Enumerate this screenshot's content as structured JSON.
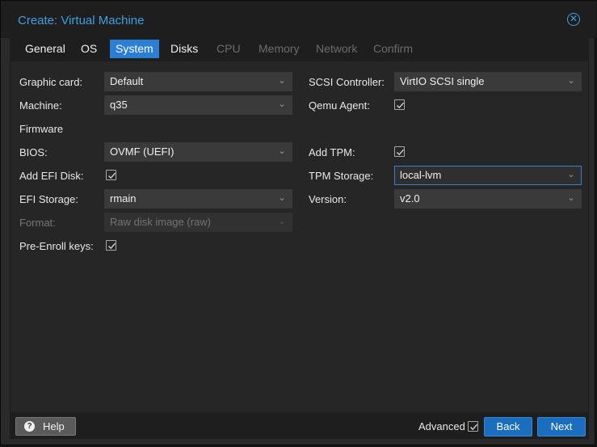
{
  "window": {
    "title": "Create: Virtual Machine"
  },
  "tabs": [
    {
      "label": "General",
      "state": "normal"
    },
    {
      "label": "OS",
      "state": "normal"
    },
    {
      "label": "System",
      "state": "active"
    },
    {
      "label": "Disks",
      "state": "normal"
    },
    {
      "label": "CPU",
      "state": "disabled"
    },
    {
      "label": "Memory",
      "state": "disabled"
    },
    {
      "label": "Network",
      "state": "disabled"
    },
    {
      "label": "Confirm",
      "state": "disabled"
    }
  ],
  "left": {
    "graphic_card": {
      "label": "Graphic card:",
      "value": "Default"
    },
    "machine": {
      "label": "Machine:",
      "value": "q35"
    },
    "firmware_heading": "Firmware",
    "bios": {
      "label": "BIOS:",
      "value": "OVMF (UEFI)"
    },
    "add_efi_disk": {
      "label": "Add EFI Disk:",
      "checked": true
    },
    "efi_storage": {
      "label": "EFI Storage:",
      "value": "rmain"
    },
    "format": {
      "label": "Format:",
      "value": "Raw disk image (raw)",
      "disabled": true
    },
    "pre_enroll": {
      "label": "Pre-Enroll keys:",
      "checked": true
    }
  },
  "right": {
    "scsi_controller": {
      "label": "SCSI Controller:",
      "value": "VirtIO SCSI single"
    },
    "qemu_agent": {
      "label": "Qemu Agent:",
      "checked": true
    },
    "add_tpm": {
      "label": "Add TPM:",
      "checked": true
    },
    "tpm_storage": {
      "label": "TPM Storage:",
      "value": "local-lvm"
    },
    "version": {
      "label": "Version:",
      "value": "v2.0"
    }
  },
  "footer": {
    "help_label": "Help",
    "advanced_label": "Advanced",
    "advanced_checked": true,
    "back_label": "Back",
    "next_label": "Next"
  },
  "icons": {
    "close": "close-circle-icon",
    "help": "question-circle-icon",
    "dropdown": "chevron-down-icon",
    "check": "checkmark-icon"
  },
  "colors": {
    "accent": "#2a7fd4",
    "title": "#3f9fe0",
    "button": "#1b6dbd",
    "focus_border": "#3b7fc8"
  }
}
